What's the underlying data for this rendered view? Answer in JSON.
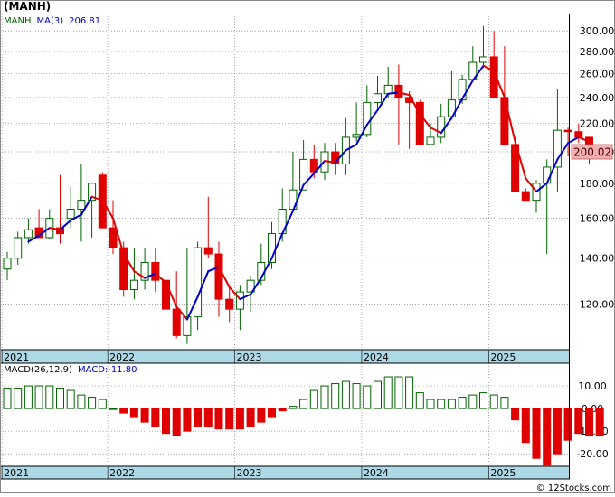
{
  "header": {
    "symbol": "(MANH)"
  },
  "watermark": "© 12Stocks.com",
  "colors": {
    "up": "#006400",
    "down": "#e00000",
    "ma": "#0000cc",
    "axisband": "#add8e6",
    "last_price_box": "#f4b0b0"
  },
  "chart_data": [
    {
      "type": "candlestick",
      "legend": {
        "symbol": "MANH",
        "ma_label": "MA(3)",
        "ma_value": "206.81"
      },
      "y_scale": "log",
      "ylim": [
        103,
        318
      ],
      "y_ticks": [
        "120.00",
        "140.00",
        "160.00",
        "180.00",
        "200.00",
        "220.00",
        "240.00",
        "260.00",
        "280.00",
        "300.00"
      ],
      "last_price": "200.02",
      "x_labels": [
        "2021",
        "2022",
        "2023",
        "2024",
        "2025"
      ],
      "x_label_month_index": [
        0,
        10,
        22,
        34,
        46
      ],
      "months": [
        "2021-03",
        "2021-04",
        "2021-05",
        "2021-06",
        "2021-07",
        "2021-08",
        "2021-09",
        "2021-10",
        "2021-11",
        "2021-12",
        "2022-01",
        "2022-02",
        "2022-03",
        "2022-04",
        "2022-05",
        "2022-06",
        "2022-07",
        "2022-08",
        "2022-09",
        "2022-10",
        "2022-11",
        "2022-12",
        "2023-01",
        "2023-02",
        "2023-03",
        "2023-04",
        "2023-05",
        "2023-06",
        "2023-07",
        "2023-08",
        "2023-09",
        "2023-10",
        "2023-11",
        "2023-12",
        "2024-01",
        "2024-02",
        "2024-03",
        "2024-04",
        "2024-05",
        "2024-06",
        "2024-07",
        "2024-08",
        "2024-09",
        "2024-10",
        "2024-11",
        "2024-12",
        "2025-01",
        "2025-02",
        "2025-03",
        "2025-04",
        "2025-05",
        "2025-06",
        "2025-07",
        "2025-08",
        "2025-09",
        "2025-10"
      ],
      "open": [
        135,
        140,
        150,
        155,
        150,
        155,
        160,
        165,
        170,
        185,
        155,
        145,
        126,
        130,
        138,
        130,
        118,
        108,
        115,
        145,
        142,
        122,
        118,
        125,
        130,
        138,
        152,
        165,
        176,
        195,
        187,
        200,
        192,
        210,
        212,
        236,
        243,
        250,
        240,
        236,
        205,
        210,
        225,
        238,
        255,
        270,
        275,
        240,
        205,
        175,
        170,
        180,
        190,
        215,
        214,
        210
      ],
      "high": [
        143,
        153,
        160,
        165,
        165,
        185,
        178,
        192,
        177,
        187,
        170,
        148,
        145,
        145,
        145,
        145,
        134,
        145,
        148,
        172,
        148,
        128,
        128,
        132,
        147,
        158,
        177,
        200,
        208,
        205,
        206,
        206,
        224,
        236,
        250,
        258,
        266,
        268,
        245,
        238,
        220,
        235,
        262,
        259,
        285,
        305,
        300,
        285,
        210,
        177,
        182,
        195,
        247,
        217,
        220,
        209
      ],
      "low": [
        130,
        137,
        147,
        150,
        149,
        147,
        155,
        148,
        150,
        155,
        142,
        123,
        122,
        126,
        125,
        121,
        107,
        105,
        110,
        140,
        115,
        113,
        110,
        117,
        128,
        135,
        148,
        165,
        176,
        183,
        182,
        185,
        185,
        207,
        210,
        232,
        240,
        205,
        202,
        208,
        205,
        206,
        223,
        235,
        258,
        265,
        270,
        210,
        175,
        170,
        163,
        142,
        175,
        197,
        206,
        192
      ],
      "close": [
        140,
        150,
        154,
        150,
        160,
        152,
        165,
        170,
        180,
        155,
        145,
        126,
        130,
        138,
        130,
        118,
        108,
        115,
        145,
        142,
        122,
        118,
        125,
        130,
        138,
        152,
        165,
        176,
        195,
        187,
        200,
        192,
        210,
        212,
        236,
        243,
        250,
        240,
        236,
        205,
        210,
        225,
        238,
        255,
        270,
        275,
        240,
        205,
        175,
        170,
        180,
        190,
        215,
        214,
        210,
        200
      ],
      "ma": [
        null,
        null,
        148,
        151,
        155,
        154,
        159,
        162,
        172,
        170,
        160,
        142,
        134,
        131,
        133,
        129,
        119,
        114,
        123,
        134,
        136,
        127,
        122,
        124,
        131,
        140,
        152,
        164,
        179,
        186,
        194,
        193,
        201,
        205,
        219,
        230,
        243,
        244,
        242,
        227,
        217,
        213,
        224,
        239,
        254,
        267,
        262,
        240,
        207,
        183,
        175,
        180,
        195,
        206,
        210,
        207
      ]
    },
    {
      "type": "bar",
      "legend": {
        "label": "MACD(26,12,9)",
        "value_label": "MACD:-11.80"
      },
      "ylim": [
        -25.5,
        20
      ],
      "y_ticks": [
        10,
        0,
        -10,
        -20
      ],
      "y_tick_labels": [
        "10.00",
        "0.00",
        "-10.00",
        "-20.00"
      ],
      "values": [
        9,
        9,
        10,
        10,
        10,
        9,
        8,
        6,
        5,
        4,
        0,
        -2,
        -4,
        -6,
        -8,
        -11,
        -12,
        -10,
        -8,
        -8,
        -9,
        -9,
        -9,
        -8,
        -6,
        -4,
        -1,
        1,
        4,
        8,
        10,
        11,
        12,
        11,
        10,
        12,
        14,
        14,
        14,
        7,
        4,
        4,
        4,
        5,
        6,
        7,
        6,
        5,
        -5,
        -15,
        -22,
        -25,
        -20,
        -14,
        -11,
        -12,
        -12
      ]
    }
  ]
}
